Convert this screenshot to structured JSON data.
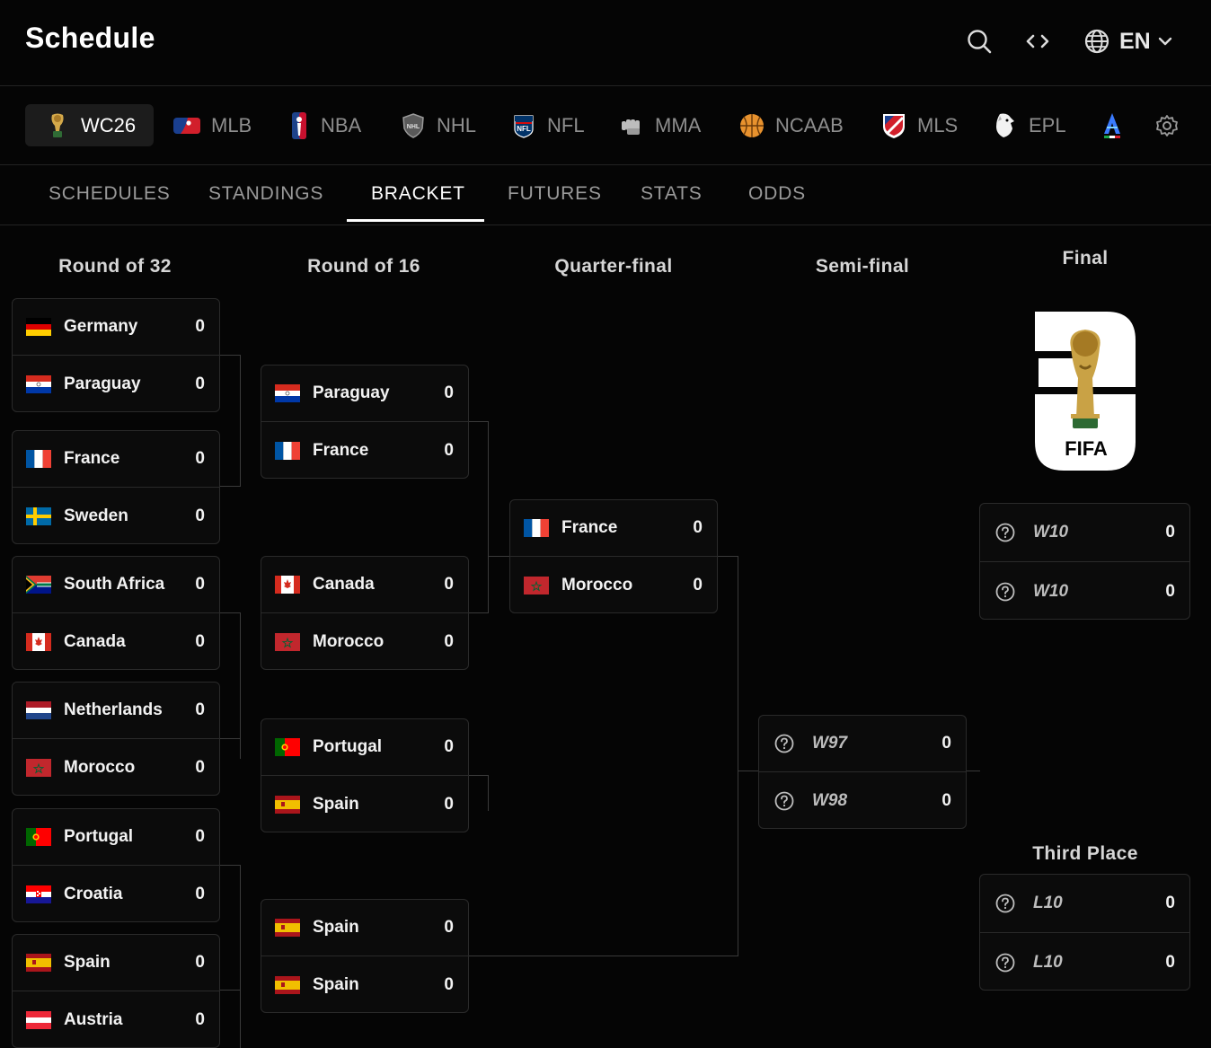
{
  "header": {
    "title": "Schedule",
    "language": "EN"
  },
  "leagues": [
    {
      "label": "WC26",
      "icon": "world-cup-trophy-icon",
      "active": true
    },
    {
      "label": "MLB",
      "icon": "mlb-logo-icon"
    },
    {
      "label": "NBA",
      "icon": "nba-logo-icon"
    },
    {
      "label": "NHL",
      "icon": "nhl-logo-icon"
    },
    {
      "label": "NFL",
      "icon": "nfl-logo-icon"
    },
    {
      "label": "MMA",
      "icon": "mma-fist-icon"
    },
    {
      "label": "NCAAB",
      "icon": "basketball-icon"
    },
    {
      "label": "MLS",
      "icon": "mls-logo-icon"
    },
    {
      "label": "EPL",
      "icon": "premier-league-lion-icon"
    },
    {
      "label": "",
      "icon": "serie-a-logo-icon"
    }
  ],
  "subtabs": [
    "SCHEDULES",
    "STANDINGS",
    "BRACKET",
    "FUTURES",
    "STATS",
    "ODDS"
  ],
  "rounds": {
    "r32": "Round of 32",
    "r16": "Round of 16",
    "qf": "Quarter-final",
    "sf": "Semi-final",
    "final": "Final",
    "third": "Third Place"
  },
  "logo_text": "FIFA",
  "bracket": {
    "r32": [
      [
        {
          "name": "Germany",
          "score": "0",
          "flag": "de"
        },
        {
          "name": "Paraguay",
          "score": "0",
          "flag": "py"
        }
      ],
      [
        {
          "name": "France",
          "score": "0",
          "flag": "fr"
        },
        {
          "name": "Sweden",
          "score": "0",
          "flag": "se"
        }
      ],
      [
        {
          "name": "South Africa",
          "score": "0",
          "flag": "za"
        },
        {
          "name": "Canada",
          "score": "0",
          "flag": "ca"
        }
      ],
      [
        {
          "name": "Netherlands",
          "score": "0",
          "flag": "nl"
        },
        {
          "name": "Morocco",
          "score": "0",
          "flag": "ma"
        }
      ],
      [
        {
          "name": "Portugal",
          "score": "0",
          "flag": "pt"
        },
        {
          "name": "Croatia",
          "score": "0",
          "flag": "hr"
        }
      ],
      [
        {
          "name": "Spain",
          "score": "0",
          "flag": "es"
        },
        {
          "name": "Austria",
          "score": "0",
          "flag": "at"
        }
      ]
    ],
    "r16": [
      [
        {
          "name": "Paraguay",
          "score": "0",
          "flag": "py"
        },
        {
          "name": "France",
          "score": "0",
          "flag": "fr"
        }
      ],
      [
        {
          "name": "Canada",
          "score": "0",
          "flag": "ca"
        },
        {
          "name": "Morocco",
          "score": "0",
          "flag": "ma"
        }
      ],
      [
        {
          "name": "Portugal",
          "score": "0",
          "flag": "pt"
        },
        {
          "name": "Spain",
          "score": "0",
          "flag": "es"
        }
      ],
      [
        {
          "name": "Spain",
          "score": "0",
          "flag": "es"
        },
        {
          "name": "Spain",
          "score": "0",
          "flag": "es"
        }
      ]
    ],
    "qf": [
      [
        {
          "name": "France",
          "score": "0",
          "flag": "fr"
        },
        {
          "name": "Morocco",
          "score": "0",
          "flag": "ma"
        }
      ]
    ],
    "sf": [
      [
        {
          "name": "W97",
          "score": "0",
          "placeholder": true
        },
        {
          "name": "W98",
          "score": "0",
          "placeholder": true
        }
      ]
    ],
    "final": [
      [
        {
          "name": "W10",
          "score": "0",
          "placeholder": true
        },
        {
          "name": "W10",
          "score": "0",
          "placeholder": true
        }
      ]
    ],
    "third": [
      [
        {
          "name": "L10",
          "score": "0",
          "placeholder": true
        },
        {
          "name": "L10",
          "score": "0",
          "placeholder": true
        }
      ]
    ]
  }
}
